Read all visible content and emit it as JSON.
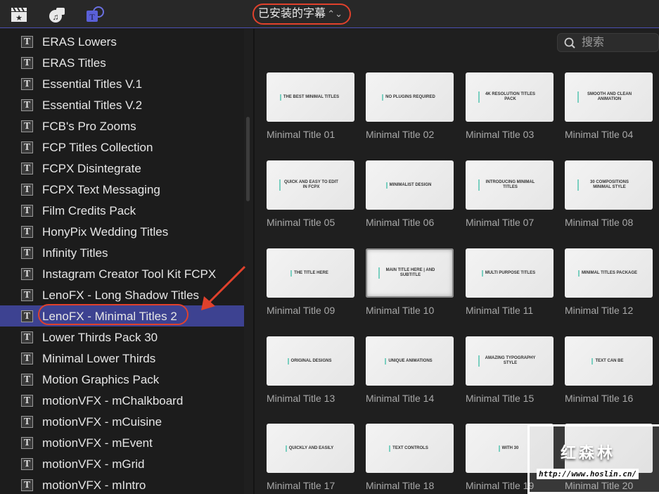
{
  "toolbar": {
    "icons": [
      "clapper-star-icon",
      "photo-music-icon",
      "titles-icon"
    ],
    "popup_label": "已安装的字幕",
    "accent": "#4a4fb0"
  },
  "search": {
    "placeholder": "搜索"
  },
  "sidebar": {
    "items": [
      "ERAS Lowers",
      "ERAS Titles",
      "Essential Titles V.1",
      "Essential Titles V.2",
      "FCB's Pro Zooms",
      "FCP Titles Collection",
      "FCPX Disintegrate",
      "FCPX Text Messaging",
      "Film Credits Pack",
      "HonyPix Wedding Titles",
      "Infinity Titles",
      "Instagram Creator Tool Kit FCPX",
      "LenoFX - Long Shadow Titles",
      "LenoFX - Minimal Titles 2",
      "Lower Thirds Pack 30",
      "Minimal Lower Thirds",
      "Motion Graphics Pack",
      "motionVFX - mChalkboard",
      "motionVFX - mCuisine",
      "motionVFX - mEvent",
      "motionVFX - mGrid",
      "motionVFX - mIntro"
    ],
    "selected_index": 13,
    "selected_color": "#3d4291"
  },
  "annotation_color": "#e0412c",
  "grid": {
    "items": [
      {
        "label": "Minimal Title 01",
        "thumb": "THE BEST MINIMAL TITLES"
      },
      {
        "label": "Minimal Title 02",
        "thumb": "NO PLUGINS REQUIRED"
      },
      {
        "label": "Minimal Title 03",
        "thumb": "4K RESOLUTION TITLES PACK"
      },
      {
        "label": "Minimal Title 04",
        "thumb": "SMOOTH AND CLEAN ANIMATION"
      },
      {
        "label": "Minimal Title 05",
        "thumb": "QUICK AND EASY TO EDIT IN FCPX"
      },
      {
        "label": "Minimal Title 06",
        "thumb": "MINIMALIST DESIGN"
      },
      {
        "label": "Minimal Title 07",
        "thumb": "INTRODUCING MINIMAL TITLES"
      },
      {
        "label": "Minimal Title 08",
        "thumb": "30 COMPOSITIONS MINIMAL STYLE"
      },
      {
        "label": "Minimal Title 09",
        "thumb": "THE TITLE HERE"
      },
      {
        "label": "Minimal Title 10",
        "thumb": "MAIN TITLE HERE | AND SUBTITLE"
      },
      {
        "label": "Minimal Title 11",
        "thumb": "MULTI PURPOSE TITLES"
      },
      {
        "label": "Minimal Title 12",
        "thumb": "MINIMAL TITLES PACKAGE"
      },
      {
        "label": "Minimal Title 13",
        "thumb": "ORIGINAL DESIGNS"
      },
      {
        "label": "Minimal Title 14",
        "thumb": "UNIQUE ANIMATIONS"
      },
      {
        "label": "Minimal Title 15",
        "thumb": "AMAZING TYPOGRAPHY STYLE"
      },
      {
        "label": "Minimal Title 16",
        "thumb": "TEXT CAN BE"
      },
      {
        "label": "Minimal Title 17",
        "thumb": "QUICKLY AND EASILY"
      },
      {
        "label": "Minimal Title 18",
        "thumb": "TEXT CONTROLS"
      },
      {
        "label": "Minimal Title 19",
        "thumb": "WITH 30"
      },
      {
        "label": "Minimal Title 20",
        "thumb": ""
      }
    ],
    "highlighted_index": 9
  },
  "watermark": {
    "text": "红森林",
    "url": "http://www.hoslin.cn/"
  }
}
